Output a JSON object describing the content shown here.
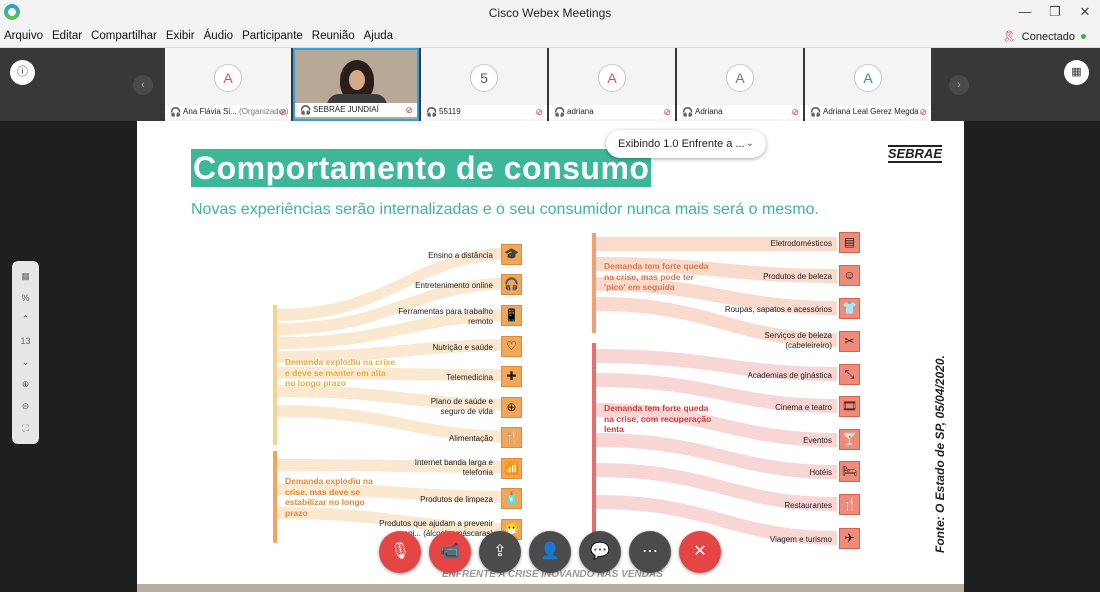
{
  "window": {
    "title": "Cisco Webex Meetings",
    "controls": [
      "—",
      "❐",
      "✕"
    ]
  },
  "menu": [
    "Arquivo",
    "Editar",
    "Compartilhar",
    "Exibir",
    "Áudio",
    "Participante",
    "Reunião",
    "Ajuda"
  ],
  "status": {
    "label": "Conectado",
    "color": "#3cb043"
  },
  "strip": {
    "left_icon": "info-icon",
    "right_icon": "calendar-icon",
    "prev": "‹",
    "next": "›"
  },
  "participants": [
    {
      "initial": "A",
      "name": "Ana Flávia Si...",
      "role": "(Organizador)",
      "color": "#e05050",
      "video": false
    },
    {
      "initial": "",
      "name": "SEBRAE JUNDIAÍ",
      "role": "",
      "color": "#333",
      "video": true
    },
    {
      "initial": "5",
      "name": "55119",
      "role": "",
      "color": "#555",
      "video": false
    },
    {
      "initial": "A",
      "name": "adriana",
      "role": "",
      "color": "#e05050",
      "video": false
    },
    {
      "initial": "A",
      "name": "Adriana",
      "role": "",
      "color": "#9b59b6",
      "video": false
    },
    {
      "initial": "A",
      "name": "Adriana Leal Gerez Megda",
      "role": "",
      "color": "#2e86de",
      "video": false
    }
  ],
  "share": {
    "label": "Exibindo 1.0 Enfrente a ...",
    "chevron": "⌄"
  },
  "sidebar": {
    "page": "13",
    "icons": [
      "grid-icon",
      "percent-icon",
      "up-icon",
      "zoom-in-icon",
      "zoom-out-icon",
      "fit-icon"
    ]
  },
  "slide": {
    "title": "Comportamento de consumo",
    "brand": "SEBRAE",
    "subtitle": "Novas experiências serão internalizadas e o seu consumidor nunca mais será o mesmo.",
    "source": "Fonte: O Estado de SP, 05/04/2020.",
    "footer": "ENFRENTE A CRISE INOVANDO NAS VENDAS",
    "groups": {
      "g1": "Demanda explodiu na crise e deve se manter em alta no longo prazo",
      "g2": "Demanda explodiu na crise, mas deve se estabilizar no longo prazo",
      "g3": "Demanda tem forte queda na crise, mas pode ter 'pico' em seguida",
      "g4": "Demanda tem forte queda na crise, com recuperação lenta"
    },
    "left_items": [
      "Ensino a distância",
      "Entretenimento online",
      "Ferramentas para trabalho remoto",
      "Nutrição e saúde",
      "Telemedicina",
      "Plano de saúde e seguro de vida",
      "Alimentação",
      "Internet banda larga e telefonia",
      "Produtos de limpeza",
      "Produtos que ajudam a prevenir epi... (álcool... máscaras)"
    ],
    "right_items": [
      "Eletrodomésticos",
      "Produtos de beleza",
      "Roupas, sapatos e acessórios",
      "Serviços de beleza (cabeleireiro)",
      "Academias de ginástica",
      "Cinema e teatro",
      "Eventos",
      "Hotéis",
      "Restaurantes",
      "Viagem e turismo"
    ]
  },
  "controls": [
    "mute-icon",
    "stop-video-icon",
    "share-icon",
    "participants-icon",
    "chat-icon",
    "more-icon",
    "leave-icon"
  ],
  "colors": {
    "accent": "#3cb898",
    "orange": "#f2a65a",
    "red": "#e54545"
  }
}
